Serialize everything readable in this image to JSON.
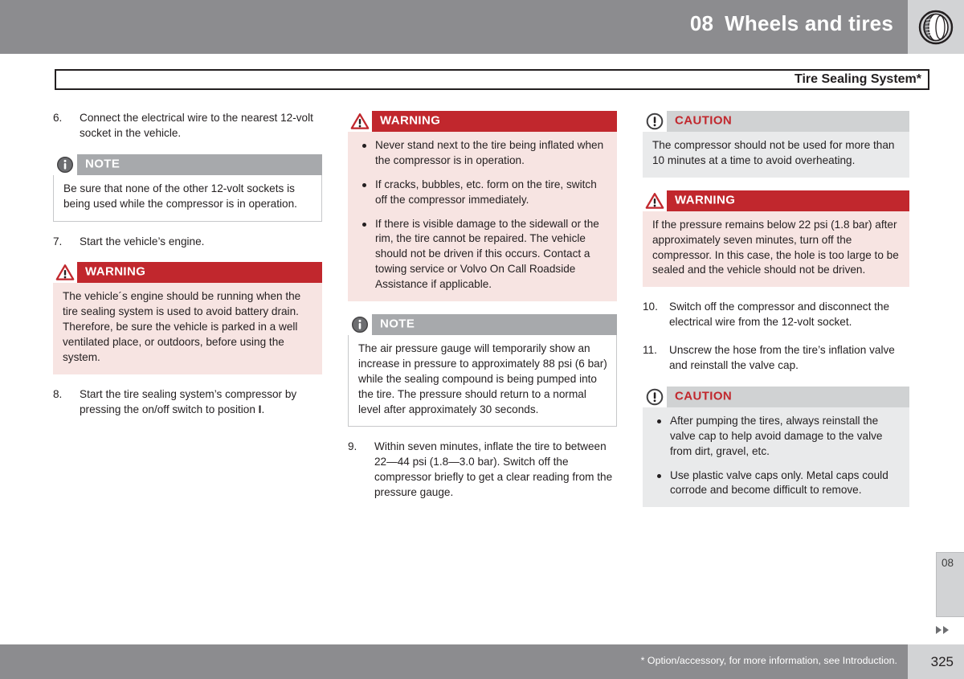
{
  "header": {
    "chapter_number": "08",
    "chapter_title": "Wheels and tires",
    "icon": "tire-icon",
    "band_color": "#8c8c8f",
    "icon_box_color": "#d2d3d5"
  },
  "title_bar": {
    "text": "Tire Sealing System*"
  },
  "columns": {
    "col1": {
      "step6": {
        "num": "6.",
        "text": "Connect the electrical wire to the nearest 12-volt socket in the vehicle."
      },
      "note1": {
        "type": "NOTE",
        "label": "NOTE",
        "icon": "info-circle-icon",
        "body": "Be sure that none of the other 12-volt sockets is being used while the compressor is in operation."
      },
      "step7": {
        "num": "7.",
        "text": "Start the vehicle’s engine."
      },
      "warning1": {
        "type": "WARNING",
        "label": "WARNING",
        "icon": "warning-triangle-icon",
        "body": "The vehicle´s engine should be running when the tire sealing system is used to avoid battery drain. Therefore, be sure the vehicle is parked in a well ventilated place, or outdoors, before using the system."
      },
      "step8": {
        "num": "8.",
        "text_before": "Start the tire sealing system’s compressor by pressing the on/off switch to position ",
        "text_bold": "I",
        "text_after": "."
      }
    },
    "col2": {
      "warning2": {
        "type": "WARNING",
        "label": "WARNING",
        "icon": "warning-triangle-icon",
        "bullets": [
          "Never stand next to the tire being inflated when the compressor is in operation.",
          "If cracks, bubbles, etc. form on the tire, switch off the compressor immediately.",
          "If there is visible damage to the sidewall or the rim, the tire cannot be repaired. The vehicle should not be driven if this occurs. Contact a towing service or Volvo On Call Roadside Assistance if applicable."
        ]
      },
      "note2": {
        "type": "NOTE",
        "label": "NOTE",
        "icon": "info-circle-icon",
        "body": "The air pressure gauge will temporarily show an increase in pressure to approximately 88 psi (6 bar) while the sealing compound is being pumped into the tire. The pressure should return to a normal level after approximately 30 seconds."
      },
      "step9": {
        "num": "9.",
        "text": "Within seven minutes, inflate the tire to between 22—44 psi (1.8—3.0 bar). Switch off the compressor briefly to get a clear reading from the pressure gauge."
      }
    },
    "col3": {
      "caution1": {
        "type": "CAUTION",
        "label": "CAUTION",
        "icon": "exclamation-circle-icon",
        "body": "The compressor should not be used for more than 10 minutes at a time to avoid overheating."
      },
      "warning3": {
        "type": "WARNING",
        "label": "WARNING",
        "icon": "warning-triangle-icon",
        "body": "If the pressure remains below 22 psi (1.8 bar) after approximately seven minutes, turn off the compressor. In this case, the hole is too large to be sealed and the vehicle should not be driven."
      },
      "step10": {
        "num": "10.",
        "text": "Switch off the compressor and disconnect the electrical wire from the 12-volt socket."
      },
      "step11": {
        "num": "11.",
        "text": "Unscrew the hose from the tire’s inflation valve and reinstall the valve cap."
      },
      "caution2": {
        "type": "CAUTION",
        "label": "CAUTION",
        "icon": "exclamation-circle-icon",
        "bullets": [
          "After pumping the tires, always reinstall the valve cap to help avoid damage to the valve from dirt, gravel, etc.",
          "Use plastic valve caps only. Metal caps could corrode and become difficult to remove."
        ]
      }
    }
  },
  "chapter_tab": {
    "label": "08"
  },
  "footer": {
    "note": "* Option/accessory, for more information, see Introduction.",
    "page_number": "325"
  },
  "colors": {
    "warning_red": "#c1272d",
    "warning_body": "#f7e4e2",
    "note_header_gray": "#a7a9ac",
    "caution_header_gray": "#d0d2d3",
    "caution_body_gray": "#e9eaeb",
    "band_gray": "#8c8c8f",
    "tab_gray": "#d2d3d5"
  }
}
